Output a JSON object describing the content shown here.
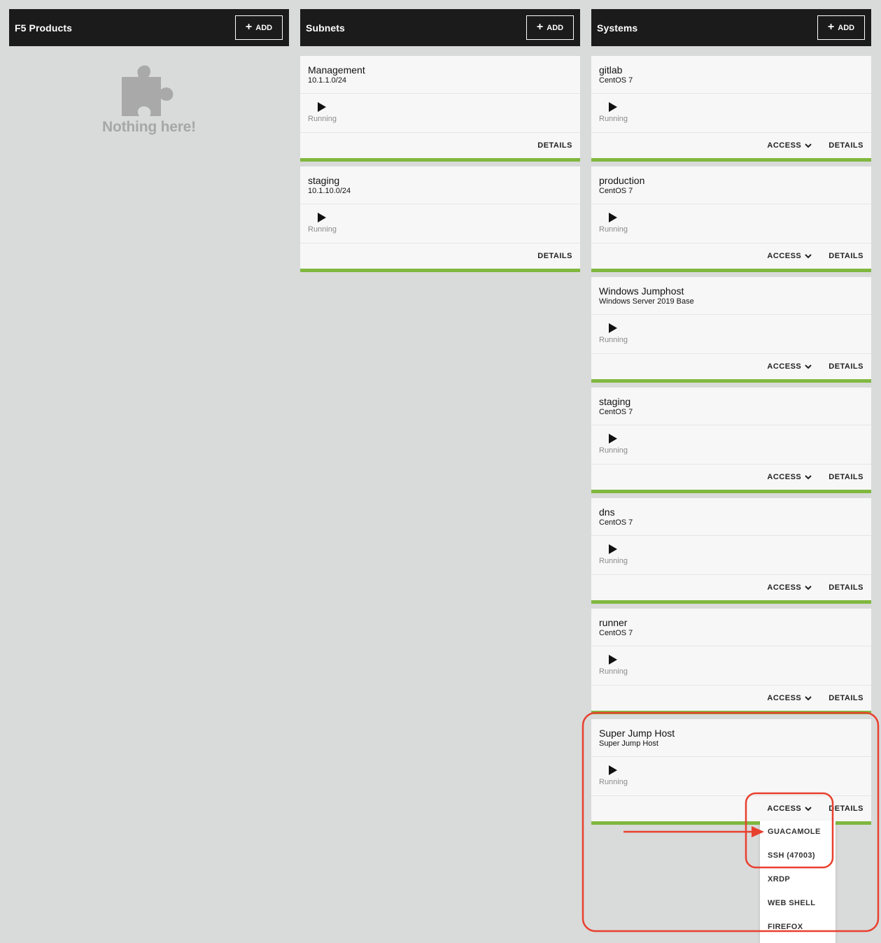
{
  "columns": {
    "products": {
      "title": "F5 Products",
      "add_label": "ADD",
      "empty_text": "Nothing here!"
    },
    "subnets": {
      "title": "Subnets",
      "add_label": "ADD",
      "cards": [
        {
          "title": "Management",
          "subtitle": "10.1.1.0/24",
          "status": "Running",
          "details_label": "DETAILS"
        },
        {
          "title": "staging",
          "subtitle": "10.1.10.0/24",
          "status": "Running",
          "details_label": "DETAILS"
        }
      ]
    },
    "systems": {
      "title": "Systems",
      "add_label": "ADD",
      "cards": [
        {
          "title": "gitlab",
          "subtitle": "CentOS 7",
          "status": "Running",
          "access_label": "ACCESS",
          "details_label": "DETAILS"
        },
        {
          "title": "production",
          "subtitle": "CentOS 7",
          "status": "Running",
          "access_label": "ACCESS",
          "details_label": "DETAILS"
        },
        {
          "title": "Windows Jumphost",
          "subtitle": "Windows Server 2019 Base",
          "status": "Running",
          "access_label": "ACCESS",
          "details_label": "DETAILS"
        },
        {
          "title": "staging",
          "subtitle": "CentOS 7",
          "status": "Running",
          "access_label": "ACCESS",
          "details_label": "DETAILS"
        },
        {
          "title": "dns",
          "subtitle": "CentOS 7",
          "status": "Running",
          "access_label": "ACCESS",
          "details_label": "DETAILS"
        },
        {
          "title": "runner",
          "subtitle": "CentOS 7",
          "status": "Running",
          "access_label": "ACCESS",
          "details_label": "DETAILS"
        },
        {
          "title": "Super Jump Host",
          "subtitle": "Super Jump Host",
          "status": "Running",
          "access_label": "ACCESS",
          "details_label": "DETAILS"
        }
      ]
    }
  },
  "access_menu": {
    "items": [
      "GUACAMOLE",
      "SSH (47003)",
      "XRDP",
      "WEB SHELL",
      "FIREFOX"
    ]
  },
  "colors": {
    "header_bg": "#1b1b1b",
    "page_bg": "#d9dada",
    "card_bg": "#f7f7f7",
    "status_bar": "#80b83f",
    "annotation": "#e8402f"
  },
  "icons": {
    "empty_state": "puzzle-piece-icon",
    "status": "play-icon",
    "access": "chevron-down-icon",
    "add": "plus-icon"
  }
}
